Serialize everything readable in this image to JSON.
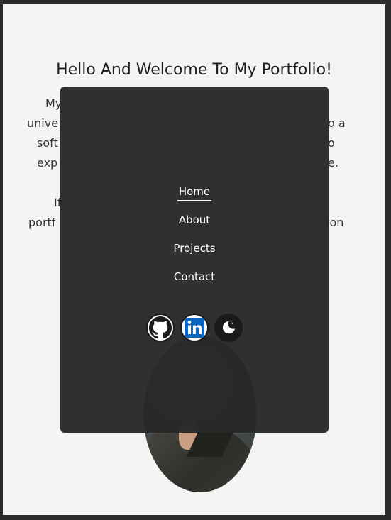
{
  "welcome": {
    "heading": "Hello And Welcome To My Portfolio!",
    "para1_lines": [
      "My",
      "unive",
      "soft",
      "exp"
    ],
    "para1_right": [
      "o a",
      "o",
      "e."
    ],
    "para2_lines": [
      "If",
      "portf"
    ],
    "para2_right": [
      "ion"
    ]
  },
  "menu": {
    "items": [
      {
        "label": "Home"
      },
      {
        "label": "About"
      },
      {
        "label": "Projects"
      },
      {
        "label": "Contact"
      }
    ]
  },
  "social": {
    "icons": [
      "github-icon",
      "linkedin-icon",
      "dark-mode-icon"
    ]
  },
  "colors": {
    "overlay": "#282828",
    "page_bg": "#f4f4f4",
    "linkedin_blue": "#0a66c2"
  }
}
